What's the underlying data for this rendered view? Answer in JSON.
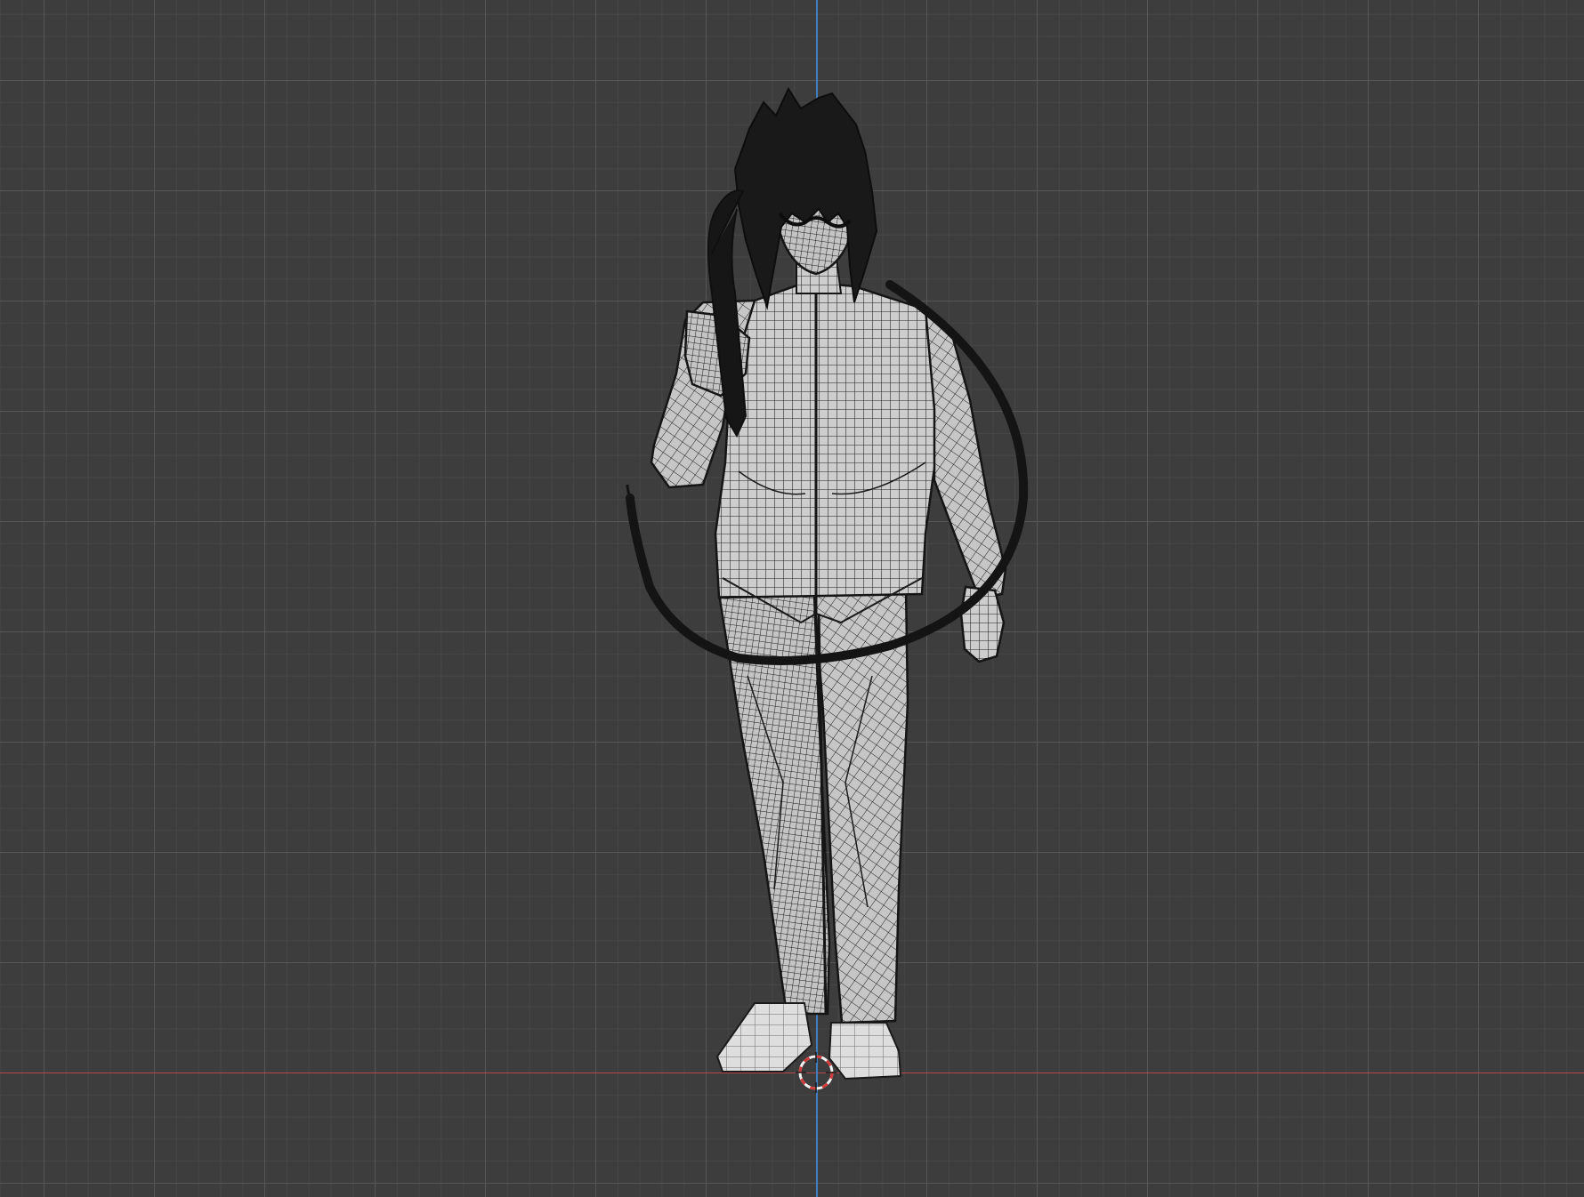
{
  "viewport": {
    "view": "front-orthographic",
    "shading": "solid-with-wireframe-overlay",
    "grid": true
  },
  "colors": {
    "background": "#3d3d3d",
    "grid_major": "#565656",
    "grid_minor": "#484848",
    "x_axis": "#b5474f",
    "z_axis": "#3f7ec2",
    "mesh_fill": "#c9c9c9",
    "mesh_wire": "#1e1e1e",
    "hair": "#1a1a1a",
    "cursor_red": "#d33a3a",
    "cursor_white": "#f2f2f2"
  },
  "objects": [
    {
      "name": "character-mesh"
    },
    {
      "name": "whip"
    },
    {
      "name": "3d-cursor"
    }
  ]
}
